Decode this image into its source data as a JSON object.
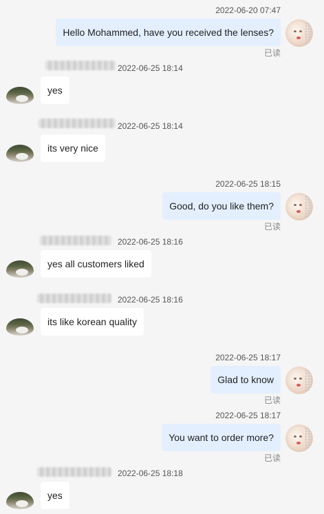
{
  "messages": [
    {
      "dir": "out",
      "time": "2022-06-20 07:47",
      "text": "Hello Mohammed, have you received the lenses?",
      "read": "已读"
    },
    {
      "dir": "in",
      "time": "2022-06-25 18:14",
      "text": "yes"
    },
    {
      "dir": "in",
      "time": "2022-06-25 18:14",
      "text": "its very nice"
    },
    {
      "dir": "out",
      "time": "2022-06-25 18:15",
      "text": "Good, do you like them?",
      "read": "已读"
    },
    {
      "dir": "in",
      "time": "2022-06-25 18:16",
      "text": "yes all customers liked"
    },
    {
      "dir": "in",
      "time": "2022-06-25 18:16",
      "text": "its like korean quality"
    },
    {
      "dir": "out",
      "time": "2022-06-25 18:17",
      "text": "Glad to know",
      "read": "已读"
    },
    {
      "dir": "out",
      "time": "2022-06-25 18:17",
      "text": "You want to order more?",
      "read": "已读"
    },
    {
      "dir": "in",
      "time": "2022-06-25 18:18",
      "text": "yes"
    }
  ]
}
